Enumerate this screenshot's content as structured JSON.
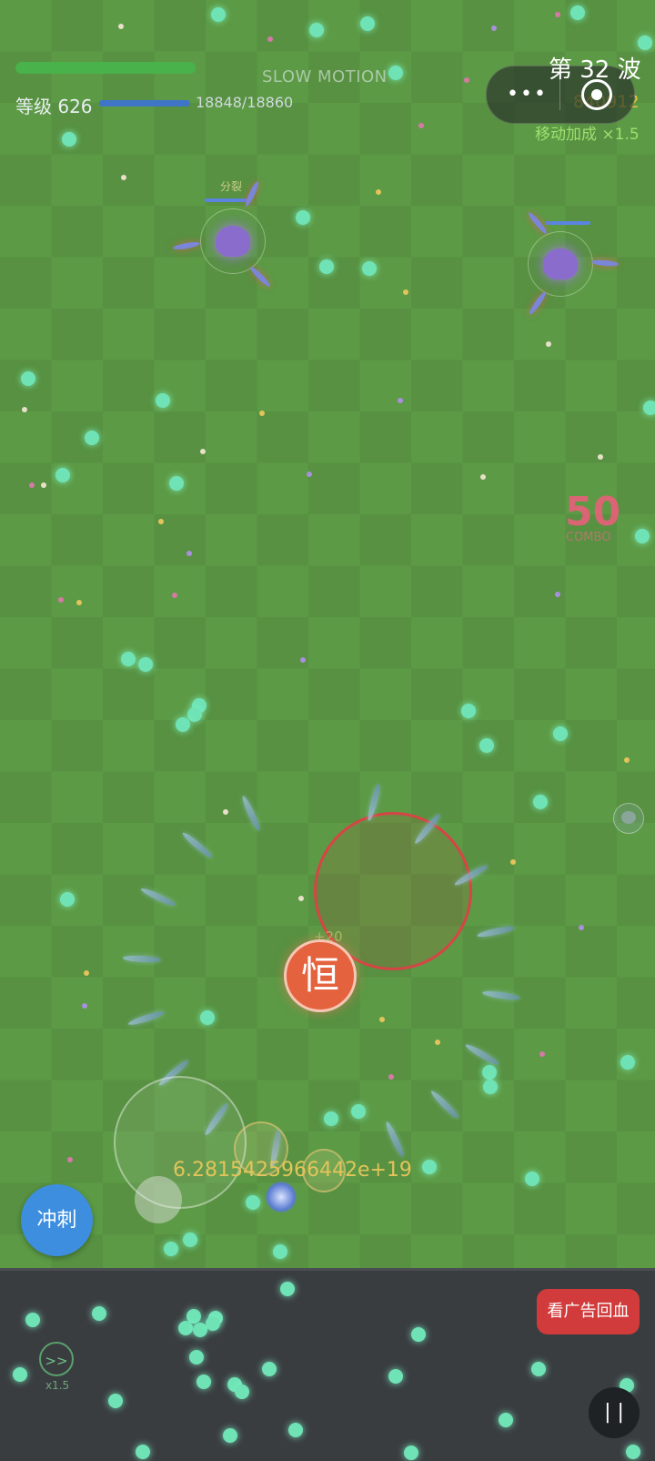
{
  "hud": {
    "level_label": "等级 626",
    "xp_text": "18848/18860",
    "xp_fraction": 0.999,
    "hp_fraction": 1.0,
    "slow_motion": "SLOW MOTION",
    "wave": "第 32 波",
    "gold": "840912",
    "speed_bonus": "移动加成 ×1.5",
    "menu_dots": "•••"
  },
  "combat": {
    "combo_count": "50",
    "combo_label": "COMBO",
    "boss_label": "分裂",
    "heng_label": "恒",
    "floating_plus": "+20",
    "damage_text": "6.2815425966442e+19"
  },
  "controls": {
    "dash_label": "冲刺",
    "ad_heal_label": "看广告回血",
    "fast_forward_icon": ">>",
    "fast_forward_mult": "x1.5",
    "pause_icon": "| |"
  },
  "colors": {
    "grass": "#5c9a45",
    "orb": "#6fe3b5",
    "hp_bar": "#49b24a",
    "xp_bar": "#3f75c6",
    "gold_text": "#e7c53a",
    "danger_ring": "#d64545",
    "dash_button": "#3e8ee0",
    "ad_button": "#d23b3b"
  },
  "icons": [
    "menu-dots-icon",
    "target-icon",
    "fast-forward-icon",
    "pause-icon"
  ]
}
